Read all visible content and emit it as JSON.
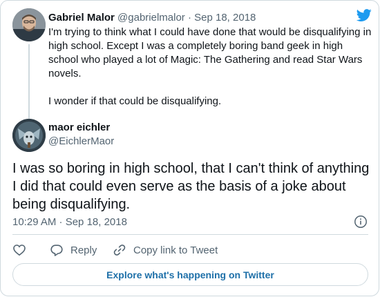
{
  "parent_tweet": {
    "name": "Gabriel Malor",
    "handle": "@gabrielmalor",
    "separator": "·",
    "date": "Sep 18, 2018",
    "paragraphs": [
      "I'm trying to think what I could have done that would be disqualifying in high school. Except I was a completely boring band geek in high school who played a lot of Magic: The Gathering and read Star Wars novels.",
      "I wonder if that could be disqualifying."
    ]
  },
  "main_tweet": {
    "name": "maor eichler",
    "handle": "@EichlerMaor",
    "text": "I was so boring in high school, that I can't think of anything I did that could even serve as the basis of a joke about being disqualifying.",
    "timestamp": "10:29 AM · Sep 18, 2018"
  },
  "actions": {
    "reply_label": "Reply",
    "copy_link_label": "Copy link to Tweet"
  },
  "explore_button": {
    "label": "Explore what's happening on Twitter"
  },
  "colors": {
    "brand_blue": "#1d9bf0",
    "link_blue": "#1d6fa8",
    "text_primary": "#0f1419",
    "text_secondary": "#536471",
    "border": "#cfd9de"
  },
  "icons": [
    "twitter-bird-icon",
    "info-icon",
    "heart-icon",
    "reply-icon",
    "link-icon"
  ]
}
